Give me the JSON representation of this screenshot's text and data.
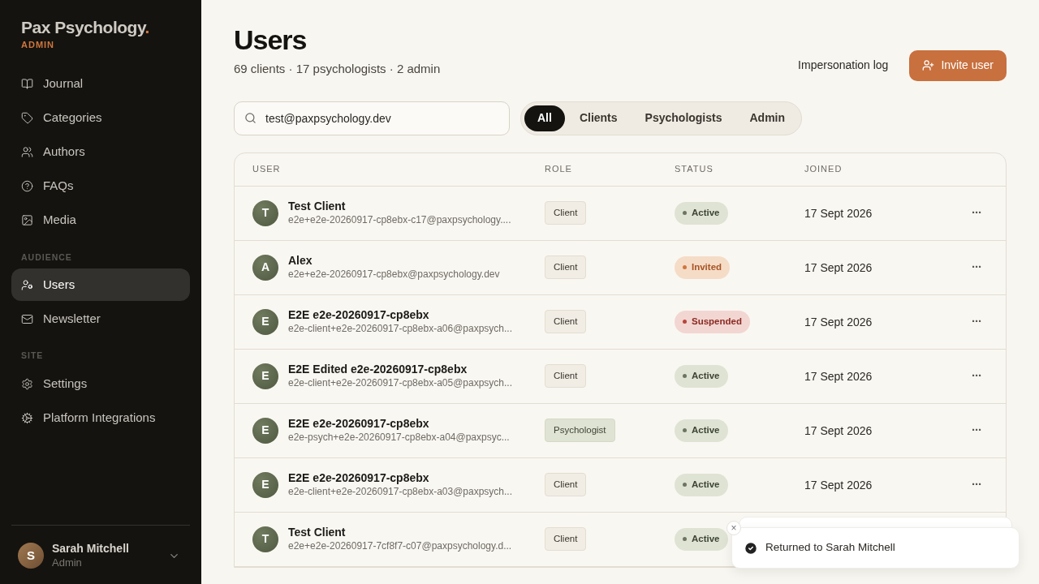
{
  "brand": {
    "name": "Pax Psychology",
    "dot": ".",
    "sub": "ADMIN"
  },
  "sidebar": {
    "sections": [
      {
        "items": [
          {
            "label": "Journal",
            "selected": false
          },
          {
            "label": "Categories",
            "selected": false
          },
          {
            "label": "Authors",
            "selected": false
          },
          {
            "label": "FAQs",
            "selected": false
          },
          {
            "label": "Media",
            "selected": false
          }
        ]
      },
      {
        "heading": "AUDIENCE",
        "items": [
          {
            "label": "Users",
            "selected": true
          },
          {
            "label": "Newsletter",
            "selected": false
          }
        ]
      },
      {
        "heading": "SITE",
        "items": [
          {
            "label": "Settings",
            "selected": false
          },
          {
            "label": "Platform Integrations",
            "selected": false
          }
        ]
      }
    ],
    "account": {
      "initial": "S",
      "name": "Sarah Mitchell",
      "role": "Admin"
    }
  },
  "page": {
    "title": "Users",
    "summary": "69 clients · 17 psychologists · 2 admin",
    "link": "Impersonation log",
    "primary_button": "Invite user"
  },
  "search": {
    "value": "test@paxpsychology.dev"
  },
  "filters": [
    {
      "label": "All",
      "selected": true
    },
    {
      "label": "Clients",
      "selected": false
    },
    {
      "label": "Psychologists",
      "selected": false
    },
    {
      "label": "Admin",
      "selected": false
    }
  ],
  "table": {
    "columns": [
      "USER",
      "ROLE",
      "STATUS",
      "JOINED"
    ],
    "rows": [
      {
        "initial": "T",
        "name": "Test Client",
        "email": "e2e+e2e-20260917-cp8ebx-c17@paxpsychology....",
        "role": {
          "label": "Client",
          "kind": "client"
        },
        "status": {
          "label": "Active",
          "kind": "active"
        },
        "joined": "17 Sept 2026",
        "menu": "···"
      },
      {
        "initial": "A",
        "name": "Alex",
        "email": "e2e+e2e-20260917-cp8ebx@paxpsychology.dev",
        "role": {
          "label": "Client",
          "kind": "client"
        },
        "status": {
          "label": "Invited",
          "kind": "invited"
        },
        "joined": "17 Sept 2026",
        "menu": "···"
      },
      {
        "initial": "E",
        "name": "E2E e2e-20260917-cp8ebx",
        "email": "e2e-client+e2e-20260917-cp8ebx-a06@paxpsych...",
        "role": {
          "label": "Client",
          "kind": "client"
        },
        "status": {
          "label": "Suspended",
          "kind": "suspended"
        },
        "joined": "17 Sept 2026",
        "menu": "···"
      },
      {
        "initial": "E",
        "name": "E2E Edited e2e-20260917-cp8ebx",
        "email": "e2e-client+e2e-20260917-cp8ebx-a05@paxpsych...",
        "role": {
          "label": "Client",
          "kind": "client"
        },
        "status": {
          "label": "Active",
          "kind": "active"
        },
        "joined": "17 Sept 2026",
        "menu": "···"
      },
      {
        "initial": "E",
        "name": "E2E e2e-20260917-cp8ebx",
        "email": "e2e-psych+e2e-20260917-cp8ebx-a04@paxpsyc...",
        "role": {
          "label": "Psychologist",
          "kind": "psychologist"
        },
        "status": {
          "label": "Active",
          "kind": "active"
        },
        "joined": "17 Sept 2026",
        "menu": "···"
      },
      {
        "initial": "E",
        "name": "E2E e2e-20260917-cp8ebx",
        "email": "e2e-client+e2e-20260917-cp8ebx-a03@paxpsych...",
        "role": {
          "label": "Client",
          "kind": "client"
        },
        "status": {
          "label": "Active",
          "kind": "active"
        },
        "joined": "17 Sept 2026",
        "menu": "···"
      },
      {
        "initial": "T",
        "name": "Test Client",
        "email": "e2e+e2e-20260917-7cf8f7-c07@paxpsychology.d...",
        "role": {
          "label": "Client",
          "kind": "client"
        },
        "status": {
          "label": "Active",
          "kind": "active"
        }
      }
    ]
  },
  "toast": {
    "message": "Returned to Sarah Mitchell",
    "close": "×"
  }
}
